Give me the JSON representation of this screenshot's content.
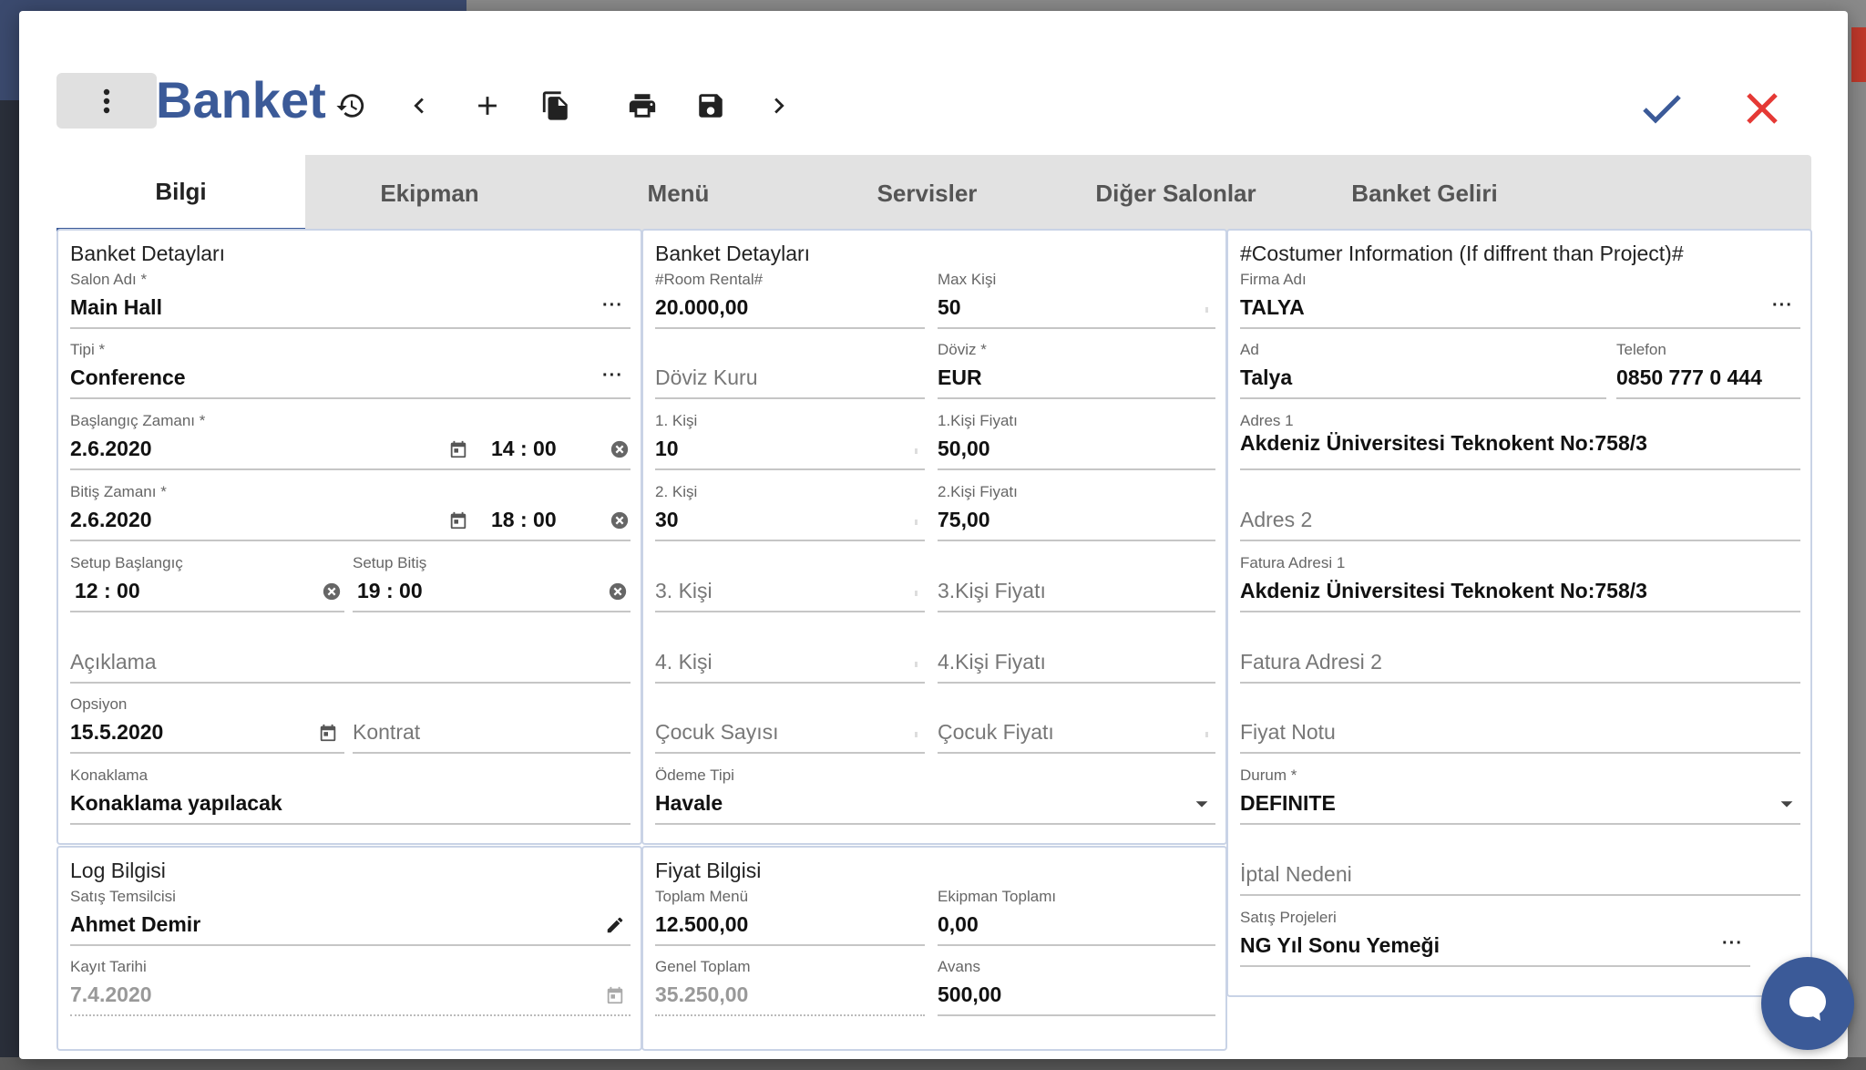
{
  "header": {
    "title": "Banket"
  },
  "tabs": [
    {
      "label": "Bilgi",
      "active": true
    },
    {
      "label": "Ekipman"
    },
    {
      "label": "Menü"
    },
    {
      "label": "Servisler"
    },
    {
      "label": "Diğer Salonlar"
    },
    {
      "label": "Banket Geliri"
    }
  ],
  "panel1": {
    "title": "Banket Detayları",
    "salon": {
      "label": "Salon Adı *",
      "value": "Main Hall"
    },
    "tipi": {
      "label": "Tipi *",
      "value": "Conference"
    },
    "baslangic": {
      "label": "Başlangıç Zamanı *",
      "date": "2.6.2020",
      "time": "14 : 00"
    },
    "bitis": {
      "label": "Bitiş Zamanı *",
      "date": "2.6.2020",
      "time": "18 : 00"
    },
    "setup_baslangic": {
      "label": "Setup Başlangıç",
      "time": "12 : 00"
    },
    "setup_bitis": {
      "label": "Setup Bitiş",
      "time": "19 : 00"
    },
    "aciklama": {
      "placeholder": "Açıklama"
    },
    "opsiyon": {
      "label": "Opsiyon",
      "value": "15.5.2020"
    },
    "kontrat": {
      "placeholder": "Kontrat"
    },
    "konaklama": {
      "label": "Konaklama",
      "value": "Konaklama yapılacak"
    }
  },
  "panel2": {
    "title": "Banket Detayları",
    "room_rental": {
      "label": "#Room Rental#",
      "value": "20.000,00"
    },
    "max_kisi": {
      "label": "Max Kişi",
      "value": "50"
    },
    "doviz_kuru": {
      "placeholder": "Döviz Kuru"
    },
    "doviz": {
      "label": "Döviz *",
      "value": "EUR"
    },
    "kisi1": {
      "label": "1. Kişi",
      "value": "10"
    },
    "kisi1_fiyat": {
      "label": "1.Kişi Fiyatı",
      "value": "50,00"
    },
    "kisi2": {
      "label": "2. Kişi",
      "value": "30"
    },
    "kisi2_fiyat": {
      "label": "2.Kişi Fiyatı",
      "value": "75,00"
    },
    "kisi3": {
      "placeholder": "3. Kişi"
    },
    "kisi3_fiyat": {
      "placeholder": "3.Kişi Fiyatı"
    },
    "kisi4": {
      "placeholder": "4. Kişi"
    },
    "kisi4_fiyat": {
      "placeholder": "4.Kişi Fiyatı"
    },
    "cocuk_sayisi": {
      "placeholder": "Çocuk Sayısı"
    },
    "cocuk_fiyati": {
      "placeholder": "Çocuk Fiyatı"
    },
    "odeme_tipi": {
      "label": "Ödeme Tipi",
      "value": "Havale"
    }
  },
  "panel3": {
    "title": "#Costumer Information (If diffrent than Project)#",
    "firma": {
      "label": "Firma Adı",
      "value": "TALYA"
    },
    "ad": {
      "label": "Ad",
      "value": "Talya"
    },
    "telefon": {
      "label": "Telefon",
      "value": "0850 777 0 444"
    },
    "adres1": {
      "label": "Adres 1",
      "value": "Akdeniz Üniversitesi Teknokent No:758/3"
    },
    "adres2": {
      "placeholder": "Adres 2"
    },
    "fatura1": {
      "label": "Fatura Adresi 1",
      "value": "Akdeniz Üniversitesi Teknokent No:758/3"
    },
    "fatura2": {
      "placeholder": "Fatura Adresi 2"
    },
    "fiyat_notu": {
      "placeholder": "Fiyat Notu"
    },
    "durum": {
      "label": "Durum *",
      "value": "DEFINITE"
    },
    "iptal": {
      "placeholder": "İptal Nedeni"
    },
    "satis_projeleri": {
      "label": "Satış Projeleri",
      "value": "NG Yıl Sonu Yemeği"
    }
  },
  "panel4": {
    "title": "Log Bilgisi",
    "temsilci": {
      "label": "Satış Temsilcisi",
      "value": "Ahmet Demir"
    },
    "kayit": {
      "label": "Kayıt Tarihi",
      "value": "7.4.2020"
    }
  },
  "panel5": {
    "title": "Fiyat Bilgisi",
    "toplam_menu": {
      "label": "Toplam Menü",
      "value": "12.500,00"
    },
    "ekipman_toplami": {
      "label": "Ekipman Toplamı",
      "value": "0,00"
    },
    "genel_toplam": {
      "label": "Genel Toplam",
      "value": "35.250,00"
    },
    "avans": {
      "label": "Avans",
      "value": "500,00"
    }
  },
  "colors": {
    "accent": "#3b5a98",
    "danger": "#e53935",
    "panel_border": "#c9d3e6"
  },
  "icons": [
    "more-vert-icon",
    "history-icon",
    "chevron-left-icon",
    "plus-icon",
    "copy-icon",
    "print-icon",
    "save-icon",
    "chevron-right-icon",
    "check-icon",
    "close-icon",
    "calendar-icon",
    "clear-icon",
    "edit-icon",
    "dropdown-arrow-icon",
    "chat-icon"
  ]
}
